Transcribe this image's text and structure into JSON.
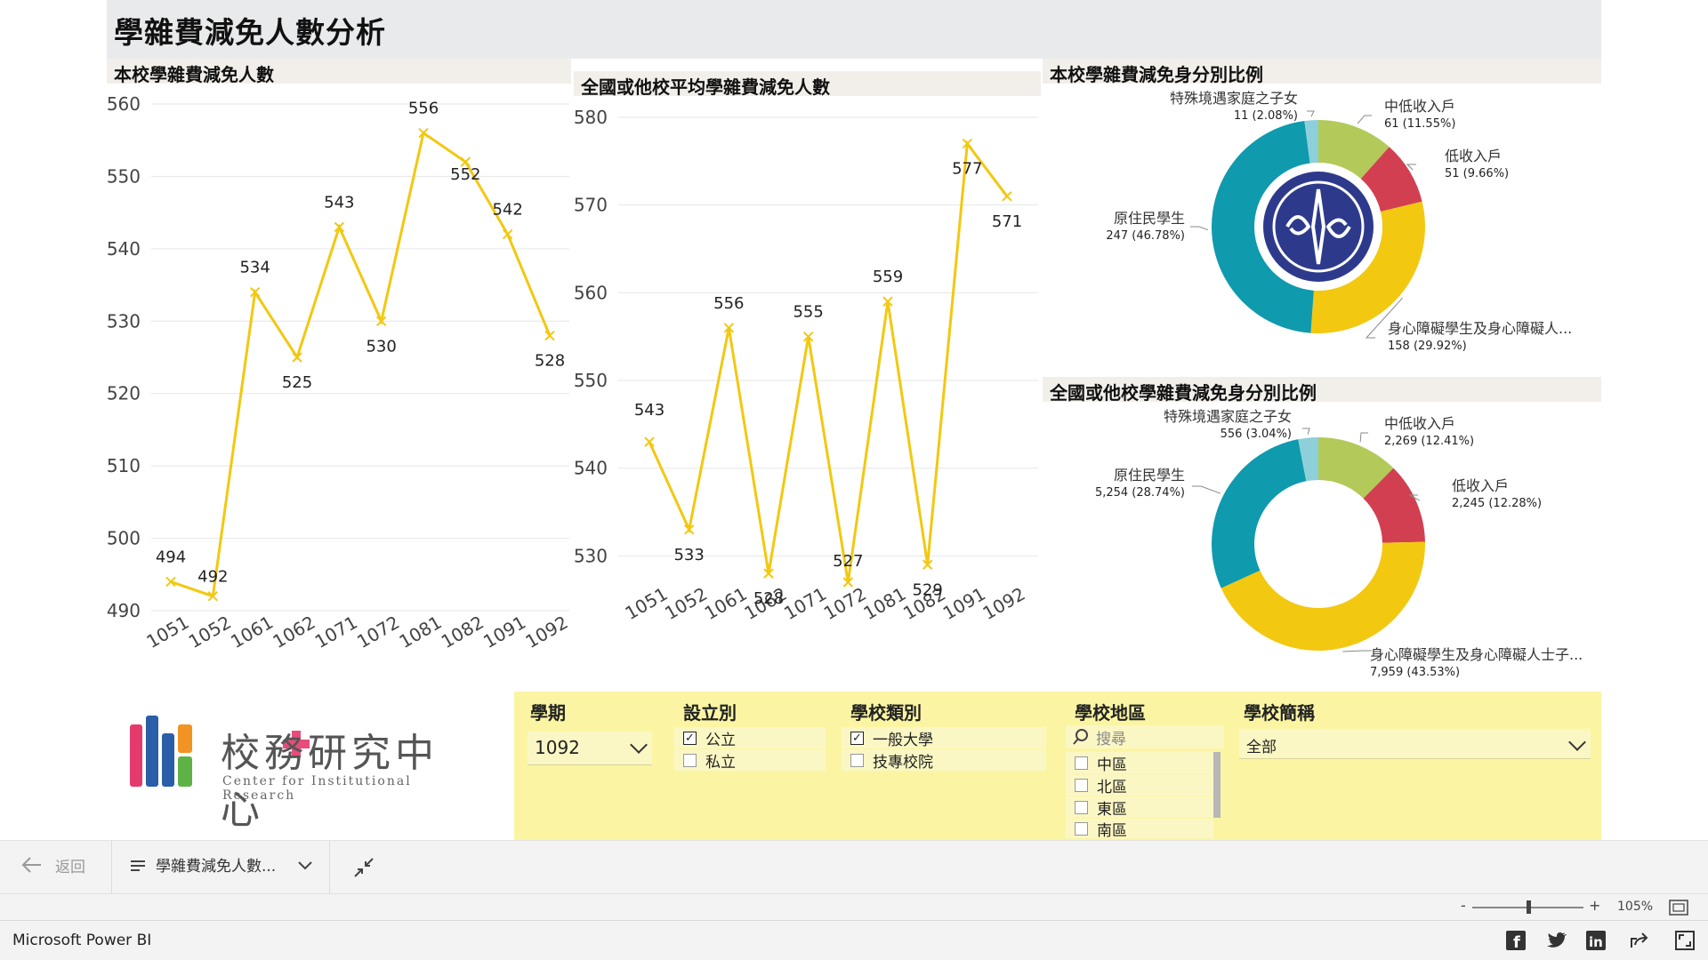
{
  "report": {
    "title": "學雜費減免人數分析"
  },
  "charts": {
    "left_title": "本校學雜費減免人數",
    "mid_title": "全國或他校平均學雜費減免人數",
    "pie1_title": "本校學雜費減免身分別比例",
    "pie2_title": "全國或他校學雜費減免身分別比例"
  },
  "chart_data": [
    {
      "type": "line",
      "title": "本校學雜費減免人數",
      "categories": [
        "1051",
        "1052",
        "1061",
        "1062",
        "1071",
        "1072",
        "1081",
        "1082",
        "1091",
        "1092"
      ],
      "values": [
        494,
        492,
        534,
        525,
        543,
        530,
        556,
        552,
        542,
        528
      ],
      "ylim": [
        490,
        560
      ],
      "yticks": [
        490,
        500,
        510,
        520,
        530,
        540,
        550,
        560
      ],
      "color": "#f2c811",
      "grid": true
    },
    {
      "type": "line",
      "title": "全國或他校平均學雜費減免人數",
      "categories": [
        "1051",
        "1052",
        "1061",
        "1062",
        "1071",
        "1072",
        "1081",
        "1082",
        "1091",
        "1092"
      ],
      "values": [
        543,
        533,
        556,
        528,
        555,
        527,
        559,
        529,
        577,
        571
      ],
      "ylim": [
        527,
        580
      ],
      "yticks": [
        530,
        540,
        550,
        560,
        570,
        580
      ],
      "color": "#f2c811",
      "grid": true
    },
    {
      "type": "pie",
      "title": "本校學雜費減免身分別比例",
      "slices": [
        {
          "label": "中低收入戶",
          "value": 61,
          "display": "61 (11.55%)",
          "color": "#b3c95a"
        },
        {
          "label": "低收入戶",
          "value": 51,
          "display": "51 (9.66%)",
          "color": "#d23f51"
        },
        {
          "label": "身心障礙學生及身心障礙人...",
          "value": 158,
          "display": "158 (29.92%)",
          "color": "#f2c811"
        },
        {
          "label": "原住民學生",
          "value": 247,
          "display": "247 (46.78%)",
          "color": "#0f9aad"
        },
        {
          "label": "特殊境遇家庭之子女",
          "value": 11,
          "display": "11 (2.08%)",
          "color": "#8dd0d9"
        }
      ]
    },
    {
      "type": "pie",
      "title": "全國或他校學雜費減免身分別比例",
      "slices": [
        {
          "label": "中低收入戶",
          "value": 2269,
          "display": "2,269 (12.41%)",
          "color": "#b3c95a"
        },
        {
          "label": "低收入戶",
          "value": 2245,
          "display": "2,245 (12.28%)",
          "color": "#d23f51"
        },
        {
          "label": "身心障礙學生及身心障礙人士子...",
          "value": 7959,
          "display": "7,959 (43.53%)",
          "color": "#f2c811"
        },
        {
          "label": "原住民學生",
          "value": 5254,
          "display": "5,254 (28.74%)",
          "color": "#0f9aad"
        },
        {
          "label": "特殊境遇家庭之子女",
          "value": 556,
          "display": "556 (3.04%)",
          "color": "#8dd0d9"
        }
      ]
    }
  ],
  "logo": {
    "name_zh": "校務研究中心",
    "name_en": "Center for Institutional Research"
  },
  "slicers": {
    "term": {
      "title": "學期",
      "value": "1092"
    },
    "establish": {
      "title": "設立別",
      "options": [
        {
          "label": "公立",
          "checked": true
        },
        {
          "label": "私立",
          "checked": false
        }
      ]
    },
    "type": {
      "title": "學校類別",
      "options": [
        {
          "label": "一般大學",
          "checked": true
        },
        {
          "label": "技專校院",
          "checked": false
        }
      ]
    },
    "region": {
      "title": "學校地區",
      "search_placeholder": "搜尋",
      "options": [
        {
          "label": "中區"
        },
        {
          "label": "北區"
        },
        {
          "label": "東區"
        },
        {
          "label": "南區"
        }
      ]
    },
    "school": {
      "title": "學校簡稱",
      "value": "全部"
    }
  },
  "nav": {
    "back_label": "返回",
    "page_label": "學雜費減免人數..."
  },
  "zoom": {
    "minus": "-",
    "plus": "+",
    "level": "105%"
  },
  "footer": {
    "brand": "Microsoft Power BI"
  }
}
